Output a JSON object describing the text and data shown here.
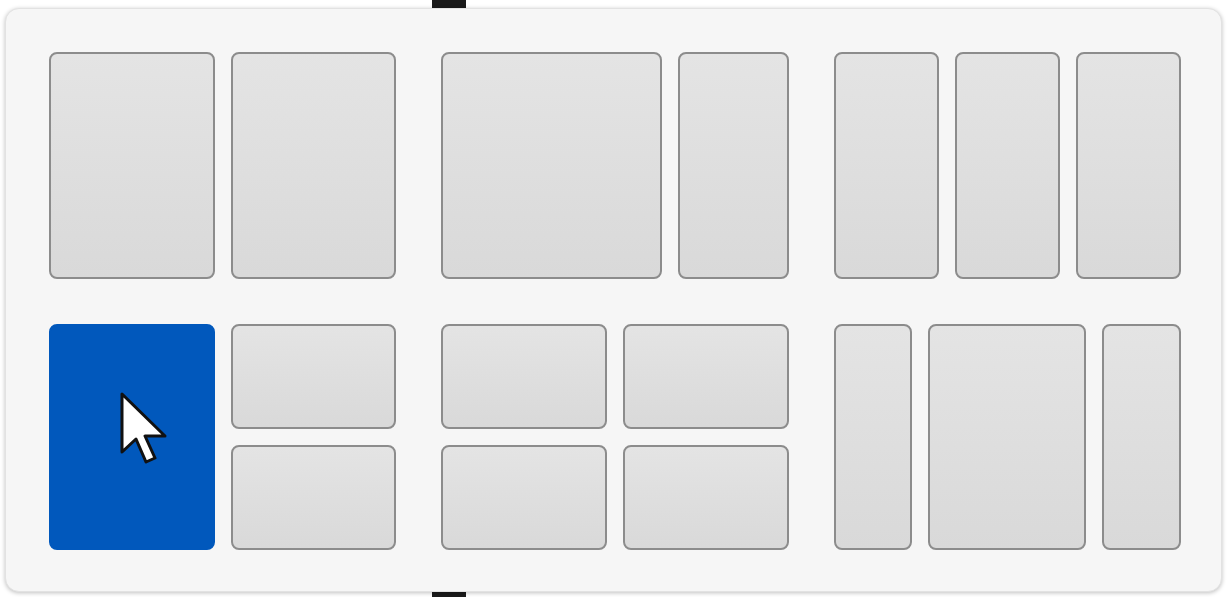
{
  "layouts": [
    {
      "kind": "halves",
      "zones": [
        {
          "selected": false
        },
        {
          "selected": false
        }
      ]
    },
    {
      "kind": "wide-left",
      "zones": [
        {
          "selected": false
        },
        {
          "selected": false
        }
      ]
    },
    {
      "kind": "thirds",
      "zones": [
        {
          "selected": false
        },
        {
          "selected": false
        },
        {
          "selected": false
        }
      ]
    },
    {
      "kind": "quad-left",
      "zones": [
        {
          "selected": true
        },
        {
          "selected": false
        },
        {
          "selected": false
        }
      ]
    },
    {
      "kind": "quarters",
      "zones": [
        {
          "selected": false
        },
        {
          "selected": false
        },
        {
          "selected": false
        },
        {
          "selected": false
        }
      ]
    },
    {
      "kind": "wide-center",
      "zones": [
        {
          "selected": false
        },
        {
          "selected": false
        },
        {
          "selected": false
        }
      ]
    }
  ]
}
